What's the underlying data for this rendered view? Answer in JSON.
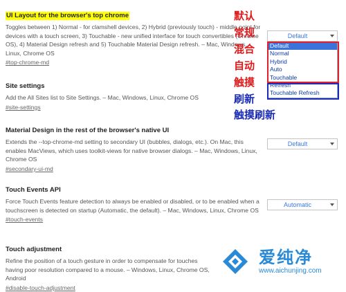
{
  "flags": [
    {
      "title": "UI Layout for the browser's top chrome",
      "desc": "Toggles between 1) Normal - for clamshell devices, 2) Hybrid (previously touch) - middle point for devices with a touch screen, 3) Touchable - new unified interface for touch convertibles (Chrome OS), 4) Material Design refresh and 5) Touchable Material Design refresh. – Mac, Windows, Linux, Chrome OS",
      "link": "#top-chrome-md",
      "select_value": "Default"
    },
    {
      "title": "Site settings",
      "desc": "Add the All Sites list to Site Settings. – Mac, Windows, Linux, Chrome OS",
      "link": "#site-settings",
      "select_value": ""
    },
    {
      "title": "Material Design in the rest of the browser's native UI",
      "desc": "Extends the --top-chrome-md setting to secondary UI (bubbles, dialogs, etc.). On Mac, this enables MacViews, which uses toolkit-views for native browser dialogs. – Mac, Windows, Linux, Chrome OS",
      "link": "#secondary-ui-md",
      "select_value": "Default"
    },
    {
      "title": "Touch Events API",
      "desc": "Force Touch Events feature detection to always be enabled or disabled, or to be enabled when a touchscreen is detected on startup (Automatic, the default). – Mac, Windows, Linux, Chrome OS",
      "link": "#touch-events",
      "select_value": "Automatic"
    },
    {
      "title": "Touch adjustment",
      "desc": "Refine the position of a touch gesture in order to compensate for touches having poor resolution compared to a mouse. – Windows, Linux, Chrome OS, Android",
      "link": "#disable-touch-adjustment",
      "select_value": ""
    }
  ],
  "dropdown_options": [
    "Default",
    "Normal",
    "Hybrid",
    "Auto",
    "Touchable",
    "Refresh",
    "Touchable Refresh"
  ],
  "annotations": {
    "red": [
      "默认",
      "常规",
      "混合",
      "自动",
      "触摸"
    ],
    "blue": [
      "刷新",
      "触摸刷新"
    ]
  },
  "watermark": {
    "text": "爱纯净",
    "url": "www.aichunjing.com"
  },
  "colors": {
    "highlight": "#ffff00",
    "accent": "#3b78e7",
    "annotation_red": "#e01a1a",
    "annotation_blue": "#1a2bb8"
  }
}
